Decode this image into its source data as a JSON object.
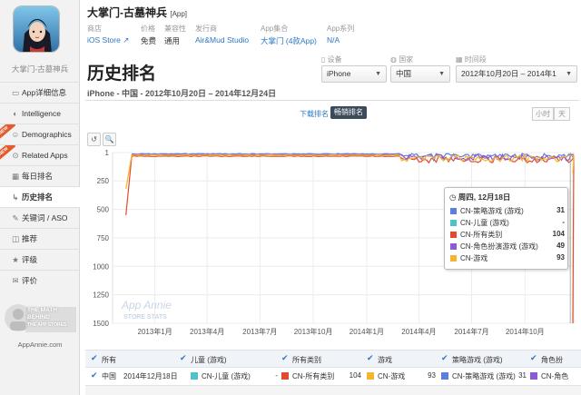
{
  "app": {
    "title": "大掌门-古墓神兵",
    "tag": "[App]",
    "short_name": "大掌门-古墓神兵",
    "meta": [
      {
        "label": "商店",
        "value": "iOS Store ↗",
        "link": true
      },
      {
        "label": "价格",
        "value": "免费",
        "link": false
      },
      {
        "label": "兼容性",
        "value": "通用",
        "link": false
      },
      {
        "label": "发行商",
        "value": "Air&Mud Studio",
        "link": true
      },
      {
        "label": "App集合",
        "value": "大掌门 (4款App)",
        "link": true
      },
      {
        "label": "App系列",
        "value": "N/A",
        "link": true
      }
    ]
  },
  "sidebar": {
    "items": [
      {
        "icon": "▭",
        "icon_name": "app-details-icon",
        "label": "App详细信息",
        "new": false,
        "active": false
      },
      {
        "icon": "◐",
        "icon_name": "intelligence-icon",
        "label": "Intelligence",
        "new": false,
        "active": false
      },
      {
        "icon": "☺",
        "icon_name": "demographics-icon",
        "label": "Demographics",
        "new": true,
        "active": false
      },
      {
        "icon": "⊙",
        "icon_name": "related-apps-icon",
        "label": "Related Apps",
        "new": true,
        "active": false
      },
      {
        "icon": "▦",
        "icon_name": "daily-rank-icon",
        "label": "每日排名",
        "new": false,
        "active": false
      },
      {
        "icon": "↳",
        "icon_name": "history-rank-icon",
        "label": "历史排名",
        "new": false,
        "active": true
      },
      {
        "icon": "✎",
        "icon_name": "keyword-icon",
        "label": "关键词 / ASO",
        "new": false,
        "active": false
      },
      {
        "icon": "◫",
        "icon_name": "featured-icon",
        "label": "推荐",
        "new": false,
        "active": false
      },
      {
        "icon": "★",
        "icon_name": "rating-icon",
        "label": "评级",
        "new": false,
        "active": false
      },
      {
        "icon": "✉",
        "icon_name": "review-icon",
        "label": "评价",
        "new": false,
        "active": false
      }
    ],
    "new_badge": "NEW",
    "math_text": [
      "THE MATH",
      "BEHIND",
      "THE APP STORES"
    ],
    "url": "AppAnnie.com"
  },
  "page": {
    "title": "历史排名",
    "subtitle": "iPhone - 中国 - 2012年10月20日 – 2014年12月24日"
  },
  "filters": {
    "device_label": "设备",
    "device_value": "iPhone",
    "country_label": "国家",
    "country_value": "中国",
    "period_label": "时间段",
    "period_value": "2012年10月20日 – 2014年1"
  },
  "tabs": {
    "download": "下载排名",
    "grossing": "畅销排名"
  },
  "units": {
    "hour": "小时",
    "day": "天"
  },
  "chart_data": {
    "type": "line",
    "y_axis": {
      "reversed": true,
      "ticks": [
        1,
        250,
        500,
        750,
        1000,
        1250,
        1500
      ],
      "range": [
        1,
        1500
      ]
    },
    "x_ticks": [
      "2013年1月",
      "2013年4月",
      "2013年7月",
      "2013年10月",
      "2014年1月",
      "2014年4月",
      "2014年7月",
      "2014年10月"
    ],
    "x_range": [
      "2012-10-20",
      "2014-12-24"
    ],
    "watermark": [
      "App Annie",
      "STORE STATS"
    ],
    "series": [
      {
        "name": "CN-策略游戏 (游戏)",
        "color": "#5b7fe0",
        "typical_rank": 10
      },
      {
        "name": "CN-儿童 (游戏)",
        "color": "#4fc1c8",
        "typical_rank": null
      },
      {
        "name": "CN-所有类别",
        "color": "#e24b2b",
        "typical_rank": 30
      },
      {
        "name": "CN-角色扮演游戏 (游戏)",
        "color": "#8a5bd6",
        "typical_rank": 15
      },
      {
        "name": "CN-游戏",
        "color": "#f5b531",
        "typical_rank": 20
      }
    ]
  },
  "tooltip": {
    "date": "周四, 12月18日",
    "rows": [
      {
        "name": "CN-策略游戏 (游戏)",
        "color": "#5b7fe0",
        "value": "31"
      },
      {
        "name": "CN-儿童 (游戏)",
        "color": "#4fc1c8",
        "value": "-"
      },
      {
        "name": "CN-所有类别",
        "color": "#e24b2b",
        "value": "104"
      },
      {
        "name": "CN-角色扮演游戏 (游戏)",
        "color": "#8a5bd6",
        "value": "49"
      },
      {
        "name": "CN-游戏",
        "color": "#f5b531",
        "value": "93"
      }
    ]
  },
  "legend": {
    "columns": [
      "所有",
      "儿童 (游戏)",
      "所有类别",
      "游戏",
      "策略游戏 (游戏)",
      "角色扮"
    ],
    "row": {
      "country": "中国",
      "date": "2014年12月18日",
      "kids": "CN-儿童 (游戏)",
      "kids_value": "-",
      "all": "CN-所有类别",
      "all_value": "104",
      "game": "CN-游戏",
      "game_value": "93",
      "strategy": "CN-策略游戏 (游戏)",
      "strategy_value": "31",
      "rpg": "CN-角色"
    }
  }
}
